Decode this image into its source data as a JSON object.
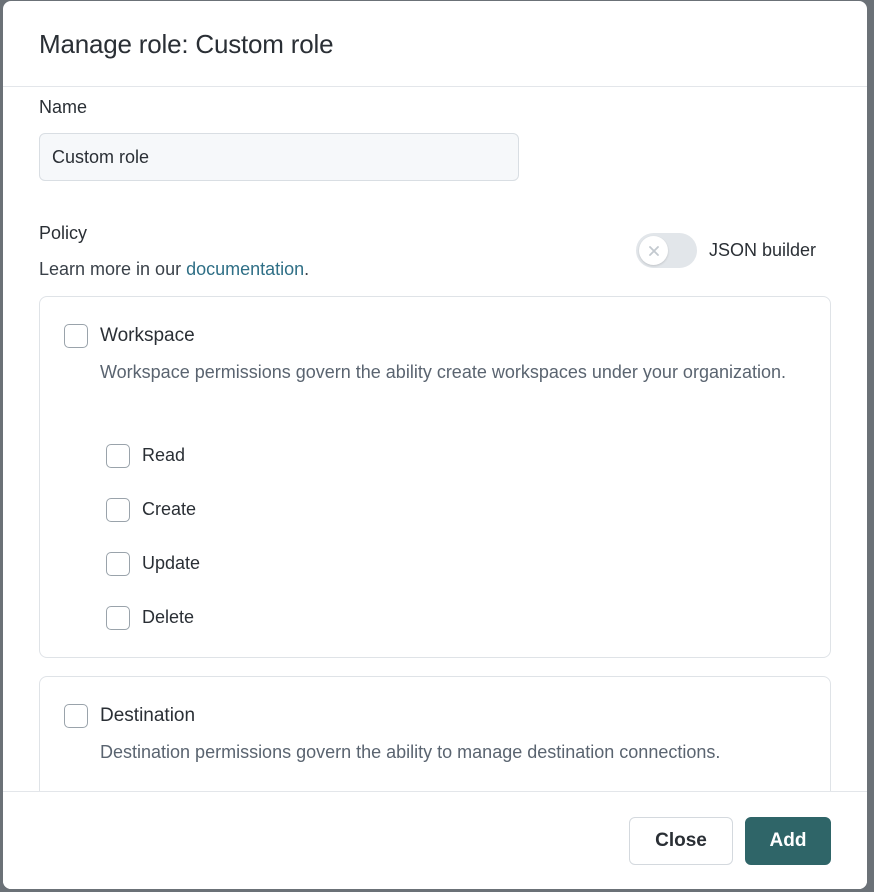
{
  "modal": {
    "title": "Manage role: Custom role"
  },
  "name_field": {
    "label": "Name",
    "value": "Custom role"
  },
  "policy": {
    "label": "Policy",
    "help_prefix": "Learn more in our ",
    "help_link": "documentation",
    "help_suffix": ".",
    "json_builder_label": "JSON builder",
    "json_builder_enabled": false
  },
  "sections": [
    {
      "title": "Workspace",
      "description": "Workspace permissions govern the ability create workspaces under your organization.",
      "checked": false,
      "permissions": [
        {
          "label": "Read",
          "checked": false
        },
        {
          "label": "Create",
          "checked": false
        },
        {
          "label": "Update",
          "checked": false
        },
        {
          "label": "Delete",
          "checked": false
        }
      ]
    },
    {
      "title": "Destination",
      "description": "Destination permissions govern the ability to manage destination connections.",
      "checked": false
    }
  ],
  "footer": {
    "close_label": "Close",
    "add_label": "Add"
  },
  "colors": {
    "primary": "#2f6568",
    "link": "#2f6f86",
    "backdrop": "#6b7177"
  }
}
